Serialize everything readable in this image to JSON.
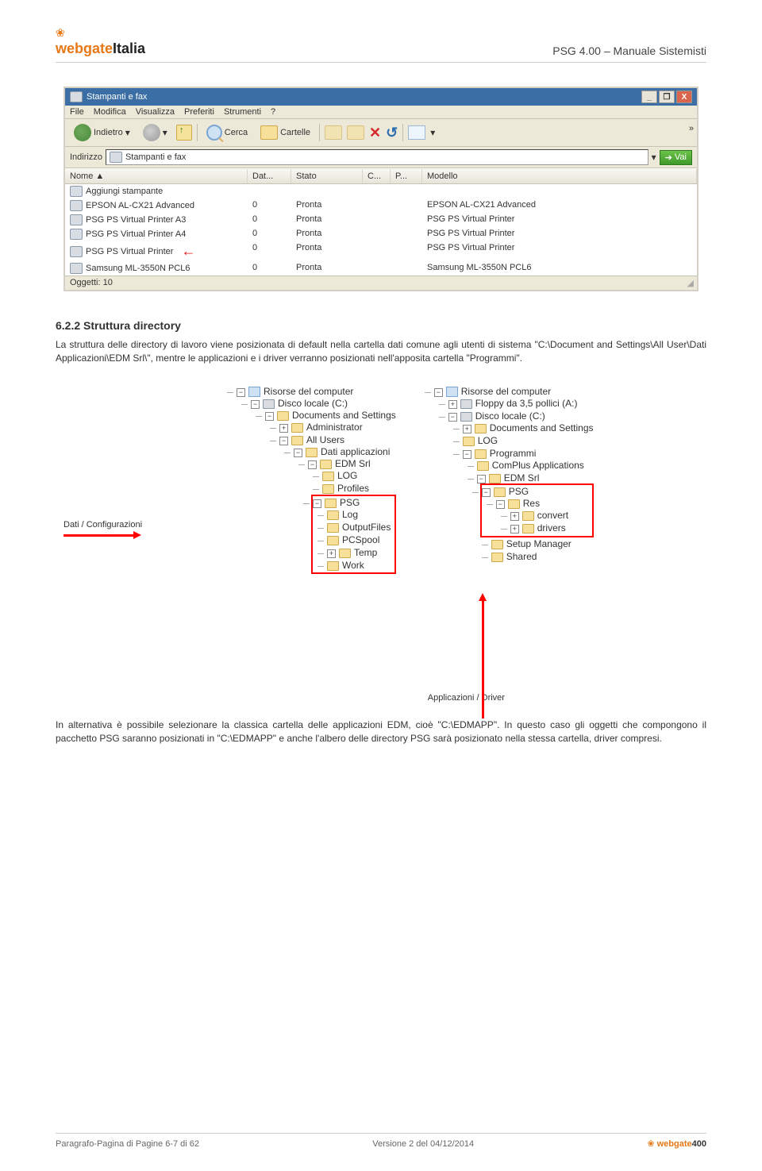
{
  "header": {
    "logo_prefix": "webgate",
    "logo_suffix": "Italia",
    "leaf": "❀",
    "right": "PSG 4.00 – Manuale Sistemisti"
  },
  "printers_window": {
    "title": "Stampanti e fax",
    "btn_min": "_",
    "btn_max": "❐",
    "btn_close": "X",
    "menu": {
      "file": "File",
      "modifica": "Modifica",
      "visualizza": "Visualizza",
      "preferiti": "Preferiti",
      "strumenti": "Strumenti",
      "help": "?"
    },
    "toolbar": {
      "back": "Indietro",
      "search": "Cerca",
      "folders": "Cartelle",
      "chev": "»"
    },
    "address": {
      "label": "Indirizzo",
      "value": "Stampanti e fax",
      "go": "Vai"
    },
    "columns": {
      "nome": "Nome  ▲",
      "dat": "Dat...",
      "stato": "Stato",
      "c": "C...",
      "p": "P...",
      "modello": "Modello"
    },
    "rows": [
      {
        "nome": "Aggiungi stampante",
        "dat": "",
        "stato": "",
        "c": "",
        "p": "",
        "modello": ""
      },
      {
        "nome": "EPSON AL-CX21 Advanced",
        "dat": "0",
        "stato": "Pronta",
        "c": "",
        "p": "",
        "modello": "EPSON AL-CX21 Advanced"
      },
      {
        "nome": "PSG PS Virtual Printer A3",
        "dat": "0",
        "stato": "Pronta",
        "c": "",
        "p": "",
        "modello": "PSG PS Virtual Printer"
      },
      {
        "nome": "PSG PS Virtual Printer A4",
        "dat": "0",
        "stato": "Pronta",
        "c": "",
        "p": "",
        "modello": "PSG PS Virtual Printer"
      },
      {
        "nome": "PSG PS Virtual Printer",
        "dat": "0",
        "stato": "Pronta",
        "c": "",
        "p": "",
        "modello": "PSG PS Virtual Printer",
        "arrow": "←"
      },
      {
        "nome": "Samsung ML-3550N PCL6",
        "dat": "0",
        "stato": "Pronta",
        "c": "",
        "p": "",
        "modello": "Samsung ML-3550N PCL6"
      }
    ],
    "status": "Oggetti: 10"
  },
  "section": {
    "heading": "6.2.2 Struttura directory",
    "para1": "La struttura delle directory di lavoro viene posizionata di default nella cartella dati comune agli utenti di sistema \"C:\\Document and Settings\\All User\\Dati Applicazioni\\EDM Srl\\\", mentre le applicazioni e i driver verranno posizionati nell'apposita cartella \"Programmi\"."
  },
  "callouts": {
    "left": "Dati / Configurazioni",
    "right": "Applicazioni / Driver"
  },
  "tree1": {
    "root": "Risorse del computer",
    "c": "Disco locale (C:)",
    "docs": "Documents and Settings",
    "admin": "Administrator",
    "allusers": "All Users",
    "dati": "Dati applicazioni",
    "edm": "EDM Srl",
    "log": "LOG",
    "profiles": "Profiles",
    "psg": "PSG",
    "psg_log": "Log",
    "psg_out": "OutputFiles",
    "psg_spool": "PCSpool",
    "temp": "Temp",
    "work": "Work"
  },
  "tree2": {
    "root": "Risorse del computer",
    "floppy": "Floppy da 3,5 pollici (A:)",
    "c": "Disco locale (C:)",
    "docs": "Documents and Settings",
    "log": "LOG",
    "prog": "Programmi",
    "complus": "ComPlus Applications",
    "edm": "EDM Srl",
    "psg": "PSG",
    "res": "Res",
    "convert": "convert",
    "drivers": "drivers",
    "setup": "Setup Manager",
    "shared": "Shared"
  },
  "para2": "In alternativa è possibile selezionare la classica cartella delle applicazioni EDM, cioè \"C:\\EDMAPP\". In questo caso gli oggetti che compongono il pacchetto PSG saranno posizionati in \"C:\\EDMAPP\" e anche l'albero delle directory PSG sarà posizionato nella stessa cartella, driver compresi.",
  "footer": {
    "left": "Paragrafo-Pagina di Pagine 6-7 di 62",
    "center": "Versione 2 del 04/12/2014",
    "logo_prefix": "webgate",
    "logo_suffix": "400",
    "leaf": "❀"
  }
}
